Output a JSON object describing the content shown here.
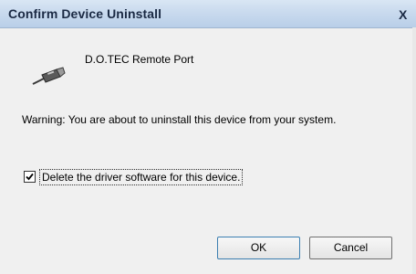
{
  "window": {
    "title": "Confirm Device Uninstall",
    "close_label": "X"
  },
  "device": {
    "name": "D.O.TEC Remote Port",
    "icon": "usb-connector-icon"
  },
  "message": {
    "warning": "Warning: You are about to uninstall this device from your system."
  },
  "options": {
    "delete_driver_label": "Delete the driver software for this device.",
    "delete_driver_checked": true
  },
  "buttons": {
    "ok_label": "OK",
    "cancel_label": "Cancel"
  }
}
